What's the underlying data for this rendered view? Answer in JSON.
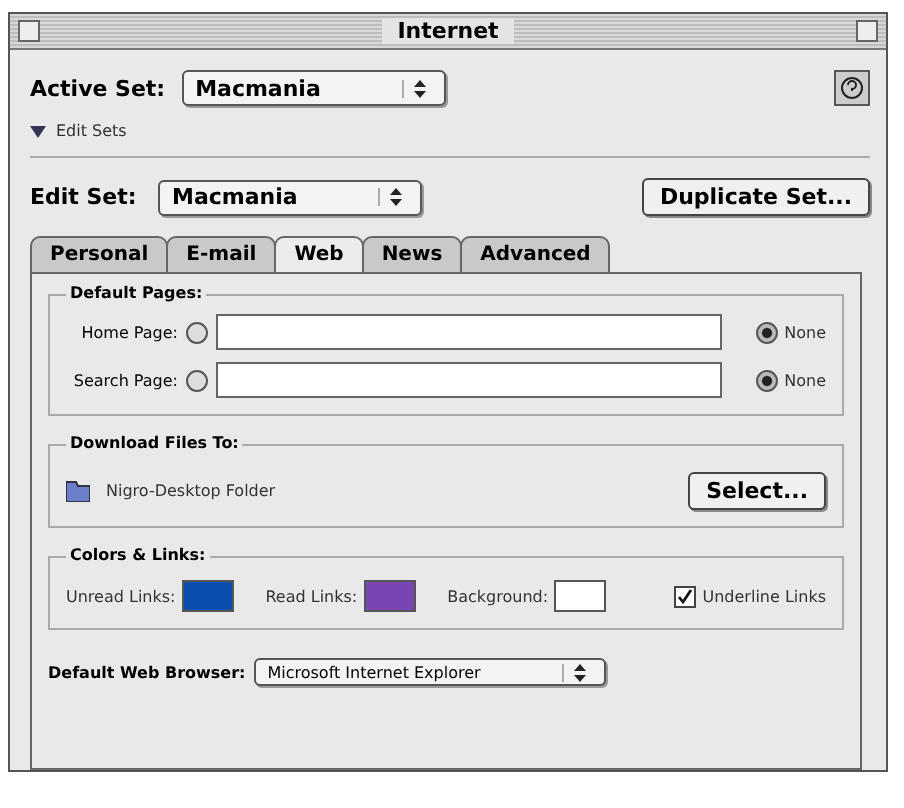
{
  "window": {
    "title": "Internet"
  },
  "active_set": {
    "label": "Active Set:",
    "value": "Macmania"
  },
  "edit_sets": {
    "label": "Edit Sets",
    "expanded": true
  },
  "edit_set": {
    "label": "Edit Set:",
    "value": "Macmania",
    "button": "Duplicate Set..."
  },
  "tabs": [
    {
      "label": "Personal",
      "selected": false
    },
    {
      "label": "E-mail",
      "selected": false
    },
    {
      "label": "Web",
      "selected": true
    },
    {
      "label": "News",
      "selected": false
    },
    {
      "label": "Advanced",
      "selected": false
    }
  ],
  "default_pages": {
    "title": "Default Pages:",
    "rows": [
      {
        "label": "Home Page:",
        "value": "",
        "choices": [
          {
            "kind": "url",
            "selected": false
          },
          {
            "kind": "none",
            "label": "None",
            "selected": true
          }
        ]
      },
      {
        "label": "Search Page:",
        "value": "",
        "choices": [
          {
            "kind": "url",
            "selected": false
          },
          {
            "kind": "none",
            "label": "None",
            "selected": true
          }
        ]
      }
    ]
  },
  "download": {
    "title": "Download Files To:",
    "folder": "Nigro-Desktop Folder",
    "button": "Select..."
  },
  "colors_links": {
    "title": "Colors & Links:",
    "swatches": [
      {
        "label": "Unread Links:",
        "color": "#0a4eb0"
      },
      {
        "label": "Read Links:",
        "color": "#7a44b4"
      },
      {
        "label": "Background:",
        "color": "#ffffff"
      }
    ],
    "underline": {
      "label": "Underline Links",
      "checked": true
    }
  },
  "browser": {
    "label": "Default Web Browser:",
    "value": "Microsoft Internet Explorer"
  }
}
